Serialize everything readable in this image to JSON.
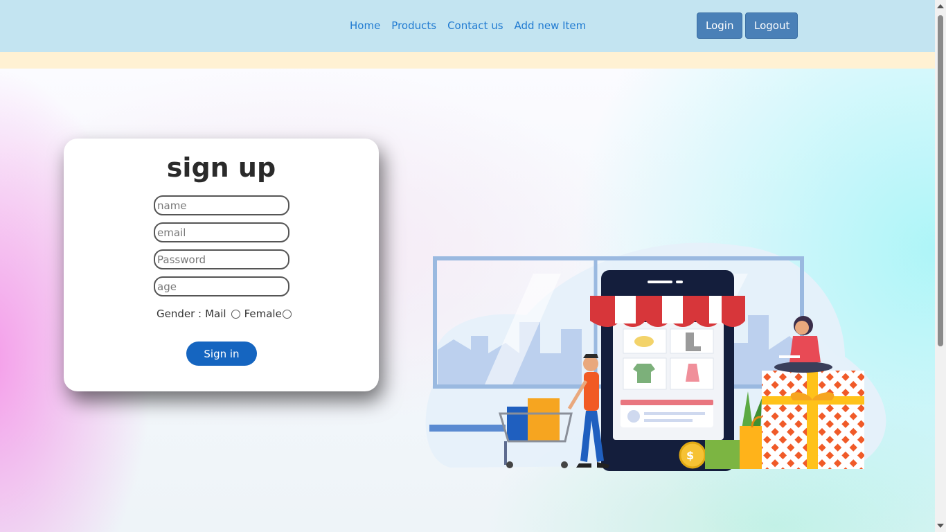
{
  "nav": {
    "links": [
      "Home",
      "Products",
      "Contact us",
      "Add new Item"
    ],
    "login_label": "Login",
    "logout_label": "Logout"
  },
  "form": {
    "title": "sign up",
    "name_placeholder": "name",
    "email_placeholder": "email",
    "password_placeholder": "Password",
    "age_placeholder": "age",
    "gender_label": "Gender :",
    "gender_options": [
      "Mail",
      "Female"
    ],
    "submit_label": "Sign in"
  },
  "illustration": {
    "icon": "online-shopping-illustration"
  },
  "colors": {
    "navbar_bg": "#c3e4f1",
    "nav_link": "#1f7ad1",
    "nav_button": "#4a80b7",
    "strip_bg": "#fff1d3",
    "submit_button": "#1565c0"
  }
}
